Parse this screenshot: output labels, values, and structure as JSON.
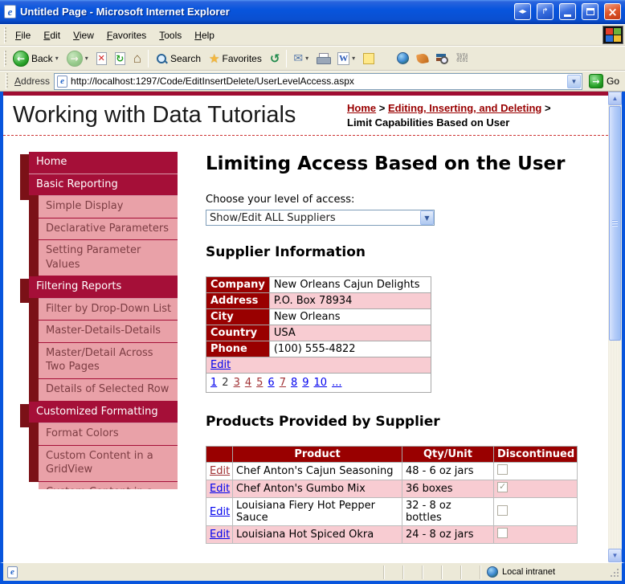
{
  "window": {
    "title": "Untitled Page - Microsoft Internet Explorer"
  },
  "menubar": {
    "items": [
      "File",
      "Edit",
      "View",
      "Favorites",
      "Tools",
      "Help"
    ]
  },
  "toolbar": {
    "back_label": "Back",
    "search_label": "Search",
    "favorites_label": "Favorites"
  },
  "addressbar": {
    "label": "Address",
    "url": "http://localhost:1297/Code/EditInsertDelete/UserLevelAccess.aspx",
    "go_label": "Go"
  },
  "header": {
    "site_title": "Working with Data Tutorials",
    "breadcrumb": {
      "home": "Home",
      "section": "Editing, Inserting, and Deleting",
      "separator": ">",
      "current": "Limit Capabilities Based on User"
    }
  },
  "sidebar": {
    "items": [
      {
        "label": "Home",
        "level": 1
      },
      {
        "label": "Basic Reporting",
        "level": 1
      },
      {
        "label": "Simple Display",
        "level": 2
      },
      {
        "label": "Declarative Parameters",
        "level": 2
      },
      {
        "label": "Setting Parameter Values",
        "level": 2
      },
      {
        "label": "Filtering Reports",
        "level": 1
      },
      {
        "label": "Filter by Drop-Down List",
        "level": 2
      },
      {
        "label": "Master-Details-Details",
        "level": 2
      },
      {
        "label": "Master/Detail Across Two Pages",
        "level": 2
      },
      {
        "label": "Details of Selected Row",
        "level": 2
      },
      {
        "label": "Customized Formatting",
        "level": 1
      },
      {
        "label": "Format Colors",
        "level": 2
      },
      {
        "label": "Custom Content in a GridView",
        "level": 2
      },
      {
        "label": "Custom Content in a DetailsView",
        "level": 2
      }
    ]
  },
  "main": {
    "page_title": "Limiting Access Based on the User",
    "access": {
      "label": "Choose your level of access:",
      "selected": "Show/Edit ALL Suppliers"
    },
    "supplier": {
      "title": "Supplier Information",
      "rows": [
        {
          "label": "Company",
          "value": "New Orleans Cajun Delights"
        },
        {
          "label": "Address",
          "value": "P.O. Box 78934"
        },
        {
          "label": "City",
          "value": "New Orleans"
        },
        {
          "label": "Country",
          "value": "USA"
        },
        {
          "label": "Phone",
          "value": "(100) 555-4822"
        }
      ],
      "edit_label": "Edit",
      "pager": [
        {
          "label": "1",
          "state": "link"
        },
        {
          "label": "2",
          "state": "current"
        },
        {
          "label": "3",
          "state": "visited"
        },
        {
          "label": "4",
          "state": "visited"
        },
        {
          "label": "5",
          "state": "visited"
        },
        {
          "label": "6",
          "state": "link"
        },
        {
          "label": "7",
          "state": "visited"
        },
        {
          "label": "8",
          "state": "link"
        },
        {
          "label": "9",
          "state": "link"
        },
        {
          "label": "10",
          "state": "link"
        },
        {
          "label": "...",
          "state": "link"
        }
      ]
    },
    "products": {
      "title": "Products Provided by Supplier",
      "columns": {
        "edit": "",
        "product": "Product",
        "qty": "Qty/Unit",
        "discontinued": "Discontinued"
      },
      "rows": [
        {
          "edit": "Edit",
          "edit_state": "visited",
          "product": "Chef Anton's Cajun Seasoning",
          "qty": "48 - 6 oz jars",
          "discontinued": "unchecked"
        },
        {
          "edit": "Edit",
          "edit_state": "link",
          "product": "Chef Anton's Gumbo Mix",
          "qty": "36 boxes",
          "discontinued": "checked"
        },
        {
          "edit": "Edit",
          "edit_state": "link",
          "product": "Louisiana Fiery Hot Pepper Sauce",
          "qty": "32 - 8 oz bottles",
          "discontinued": "unchecked"
        },
        {
          "edit": "Edit",
          "edit_state": "link",
          "product": "Louisiana Hot Spiced Okra",
          "qty": "24 - 8 oz jars",
          "discontinued": "unchecked"
        }
      ]
    }
  },
  "statusbar": {
    "zone": "Local intranet"
  },
  "colors": {
    "nav_crimson": "#a50f38",
    "nav_maroon": "#7b1117",
    "nav_pink": "#e9a1a8",
    "table_header_red": "#990000",
    "row_pink": "#f8ccd2",
    "link_blue": "#0000ee",
    "link_visited": "#a03033",
    "titlebar_blue": "#0855dd"
  }
}
